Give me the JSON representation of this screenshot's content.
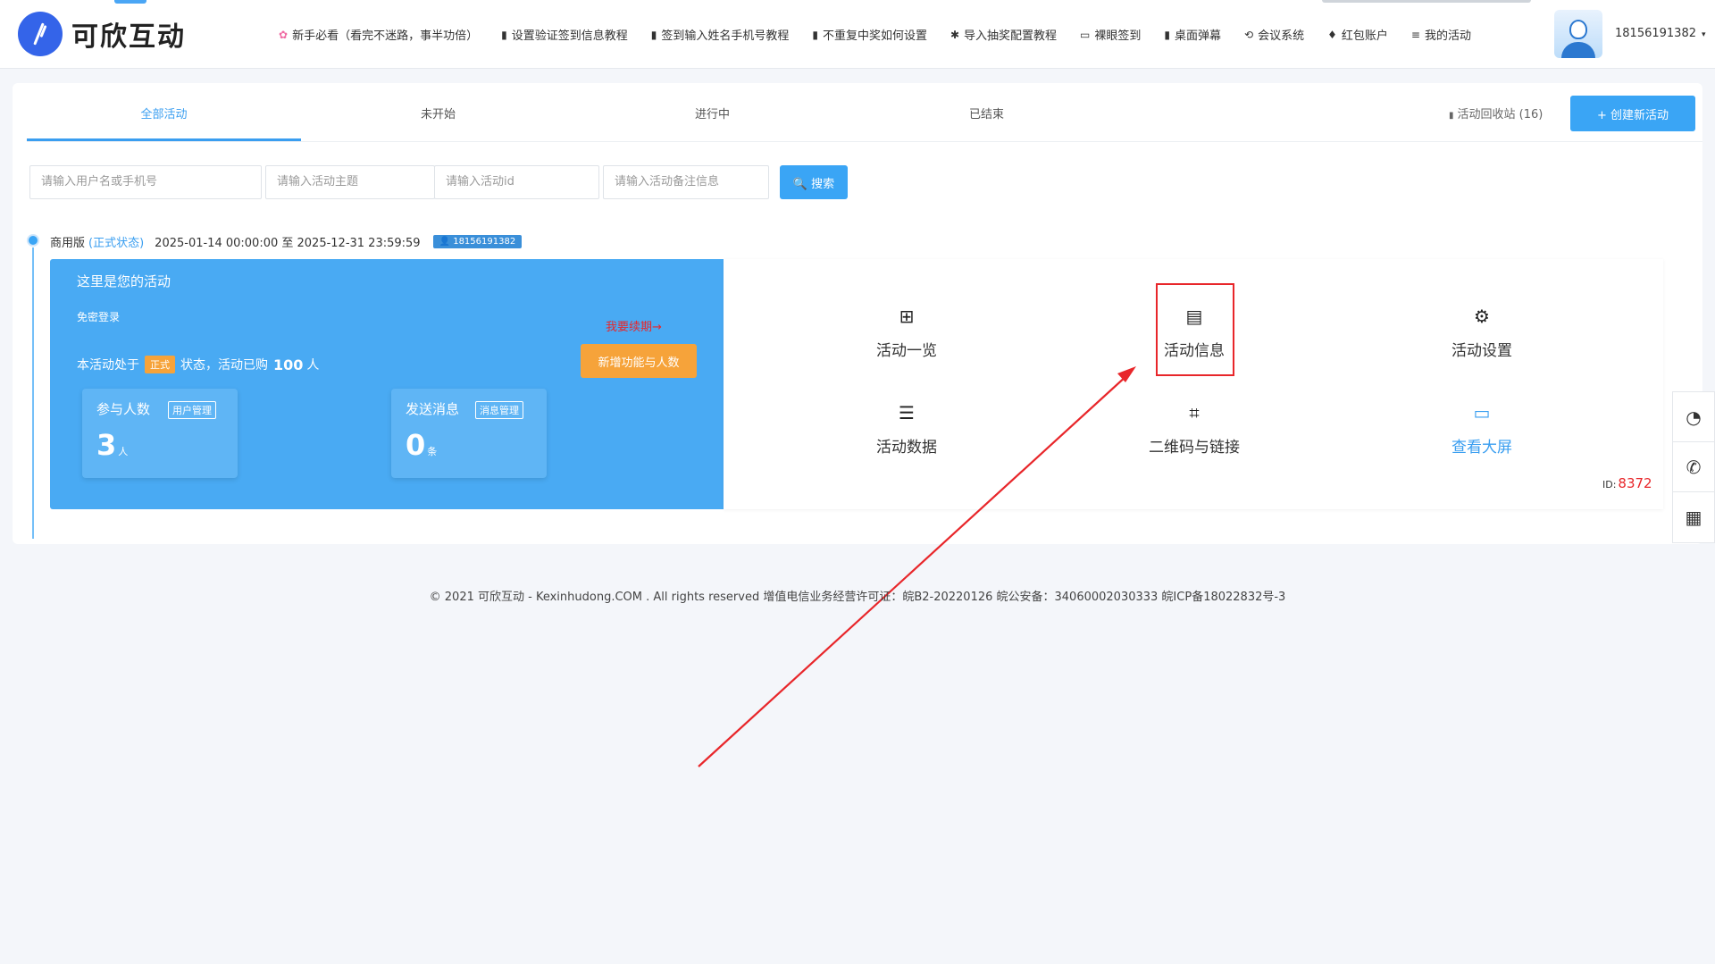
{
  "brand": {
    "name": "可欣互动"
  },
  "nav": [
    {
      "icon": "flower-icon",
      "glyph": "✿",
      "label": "新手必看（看完不迷路，事半功倍）",
      "accent": "pink"
    },
    {
      "icon": "document-icon",
      "glyph": "▮",
      "label": "设置验证签到信息教程"
    },
    {
      "icon": "document-icon",
      "glyph": "▮",
      "label": "签到输入姓名手机号教程"
    },
    {
      "icon": "document-icon",
      "glyph": "▮",
      "label": "不重复中奖如何设置"
    },
    {
      "icon": "asterisk-icon",
      "glyph": "✱",
      "label": "导入抽奖配置教程"
    },
    {
      "icon": "monitor-icon",
      "glyph": "▭",
      "label": "裸眼签到"
    },
    {
      "icon": "document-icon",
      "glyph": "▮",
      "label": "桌面弹幕"
    },
    {
      "icon": "sync-icon",
      "glyph": "⟲",
      "label": "会议系统"
    },
    {
      "icon": "gem-icon",
      "glyph": "♦",
      "label": "红包账户"
    },
    {
      "icon": "list-icon",
      "glyph": "≡",
      "label": "我的活动"
    }
  ],
  "user": {
    "phone": "18156191382",
    "caret": "▾"
  },
  "tabs": [
    "全部活动",
    "未开始",
    "进行中",
    "已结束"
  ],
  "recycle": {
    "label": "活动回收站 (16)",
    "glyph": "▮"
  },
  "create_button": "+ 创建新活动",
  "search": {
    "user_placeholder": "请输入用户名或手机号",
    "theme_placeholder": "请输入活动主题",
    "id_placeholder": "请输入活动id",
    "note_placeholder": "请输入活动备注信息",
    "button": "🔍 搜索"
  },
  "activity": {
    "edition": "商用版",
    "state": "(正式状态)",
    "time": "2025-01-14 00:00:00 至 2025-12-31 23:59:59",
    "owner": "👤 18156191382",
    "title": "这里是您的活动",
    "login": "免密登录",
    "renew": "我要续期→",
    "status_prefix": "本活动处于",
    "status_tag": "正式",
    "status_mid": "状态，活动已购",
    "purchased": "100",
    "status_suffix": "人",
    "add_feature": "新增功能与人数",
    "participants": {
      "label": "参与人数",
      "button": "用户管理",
      "value": "3",
      "unit": "人"
    },
    "messages": {
      "label": "发送消息",
      "button": "消息管理",
      "value": "0",
      "unit": "条"
    },
    "id_label": "ID:",
    "id": "8372"
  },
  "functions": [
    {
      "label": "活动一览",
      "icon": "grid-icon",
      "glyph": "⊞"
    },
    {
      "label": "活动信息",
      "icon": "file-icon",
      "glyph": "▤"
    },
    {
      "label": "活动设置",
      "icon": "gear-icon",
      "glyph": "⚙"
    },
    {
      "label": "活动数据",
      "icon": "database-icon",
      "glyph": "☰"
    },
    {
      "label": "二维码与链接",
      "icon": "scan-icon",
      "glyph": "⌗"
    },
    {
      "label": "查看大屏",
      "icon": "laptop-icon",
      "glyph": "▭"
    }
  ],
  "footer": "© 2021 可欣互动 - Kexinhudong.COM . All rights reserved 增值电信业务经营许可证：皖B2-20220126 皖公安备：34060002030333 皖ICP备18022832号-3",
  "side_float": [
    {
      "icon": "qq-icon",
      "glyph": "◔"
    },
    {
      "icon": "phone-icon",
      "glyph": "✆"
    },
    {
      "icon": "qrcode-icon",
      "glyph": "▦"
    }
  ],
  "colors": {
    "accent": "#3aa5f5",
    "panel": "#49aaf3",
    "orange": "#f6a33a",
    "red": "#e8262a"
  }
}
